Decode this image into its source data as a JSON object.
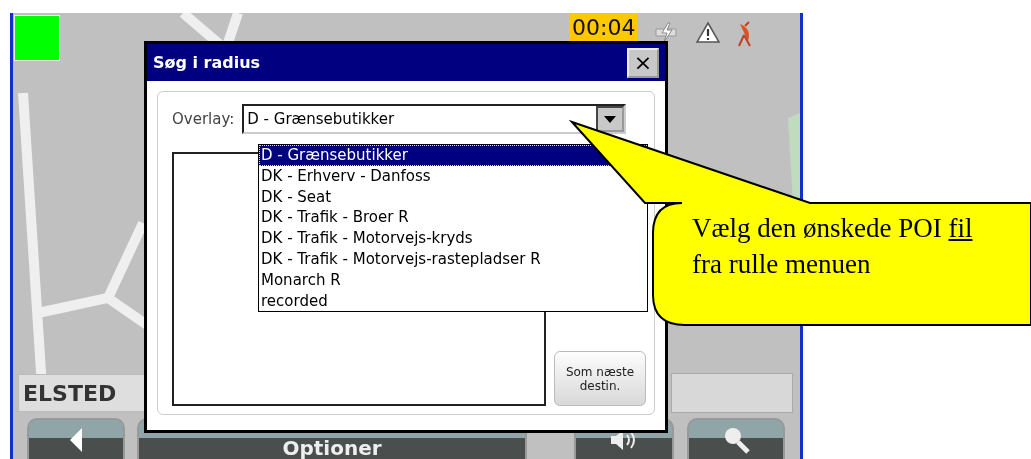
{
  "status": {
    "time": "00:04"
  },
  "location": {
    "place": "ELSTED"
  },
  "bottom_bar": {
    "center_button": "Optioner"
  },
  "dialog": {
    "title": "Søg i radius",
    "close": "×",
    "overlay_label": "Overlay:",
    "overlay_value": "D - Grænsebutikker",
    "dropdown": {
      "expanded": true,
      "options": [
        {
          "label": "D - Grænsebutikker",
          "selected": true
        },
        {
          "label": "DK - Erhverv - Danfoss",
          "selected": false
        },
        {
          "label": "DK - Seat",
          "selected": false
        },
        {
          "label": "DK - Trafik - Broer R",
          "selected": false
        },
        {
          "label": "DK - Trafik - Motorvejs-kryds",
          "selected": false
        },
        {
          "label": "DK - Trafik - Motorvejs-rastepladser R",
          "selected": false
        },
        {
          "label": "Monarch R",
          "selected": false
        },
        {
          "label": "recorded",
          "selected": false
        }
      ]
    },
    "buttons": [
      "Som næste destin."
    ]
  },
  "callout": {
    "parts": [
      {
        "text": "Vælg den ønskede POI",
        "underline": false
      },
      {
        "text": "fil",
        "underline": true
      },
      {
        "text": "fra rulle menuen",
        "underline": false
      }
    ]
  }
}
